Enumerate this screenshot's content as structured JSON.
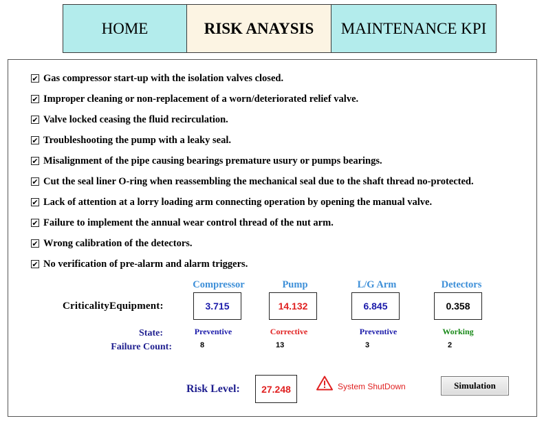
{
  "tabs": {
    "home": "HOME",
    "risk": "RISK ANAYSIS",
    "kpi": "MAINTENANCE KPI"
  },
  "checklist": [
    {
      "label": "Gas compressor start-up with the isolation valves closed.",
      "checked": true
    },
    {
      "label": "Improper cleaning or non-replacement of a worn/deteriorated relief valve.",
      "checked": true
    },
    {
      "label": "Valve locked ceasing the fluid recirculation.",
      "checked": true
    },
    {
      "label": "Troubleshooting the pump with a leaky seal.",
      "checked": true
    },
    {
      "label": "Misalignment of the pipe causing bearings premature usury or pumps bearings.",
      "checked": true
    },
    {
      "label": "Cut the seal liner O-ring when reassembling the mechanical seal due to the shaft thread no-protected.",
      "checked": true
    },
    {
      "label": "Lack of attention at a lorry loading arm connecting operation by opening the manual valve.",
      "checked": true
    },
    {
      "label": "Failure to implement the annual wear control thread of the nut arm.",
      "checked": true
    },
    {
      "label": "Wrong calibration of the detectors.",
      "checked": true
    },
    {
      "label": "No verification of pre-alarm and alarm triggers.",
      "checked": true
    }
  ],
  "checkmark": "✔",
  "criticality": {
    "label": "CriticalityEquipment:",
    "state_label": "State:",
    "count_label": "Failure Count:",
    "equipment": [
      {
        "name": "Compressor",
        "value": "3.715",
        "value_color": "#1a1aaa",
        "state": "Preventive",
        "state_color": "#1a1aaa",
        "failure_count": "8"
      },
      {
        "name": "Pump",
        "value": "14.132",
        "value_color": "#e02020",
        "state": "Corrective",
        "state_color": "#e02020",
        "failure_count": "13"
      },
      {
        "name": "L/G Arm",
        "value": "6.845",
        "value_color": "#1a1aaa",
        "state": "Preventive",
        "state_color": "#1a1aaa",
        "failure_count": "3"
      },
      {
        "name": "Detectors",
        "value": "0.358",
        "value_color": "#000000",
        "state": "Working",
        "state_color": "#1a8a1a",
        "failure_count": "2"
      }
    ]
  },
  "risk": {
    "label": "Risk Level:",
    "value": "27.248",
    "value_color": "#e02020"
  },
  "alert": {
    "icon": "warning-icon",
    "text": "System ShutDown",
    "color": "#e02020"
  },
  "simulation_button": "Simulation"
}
